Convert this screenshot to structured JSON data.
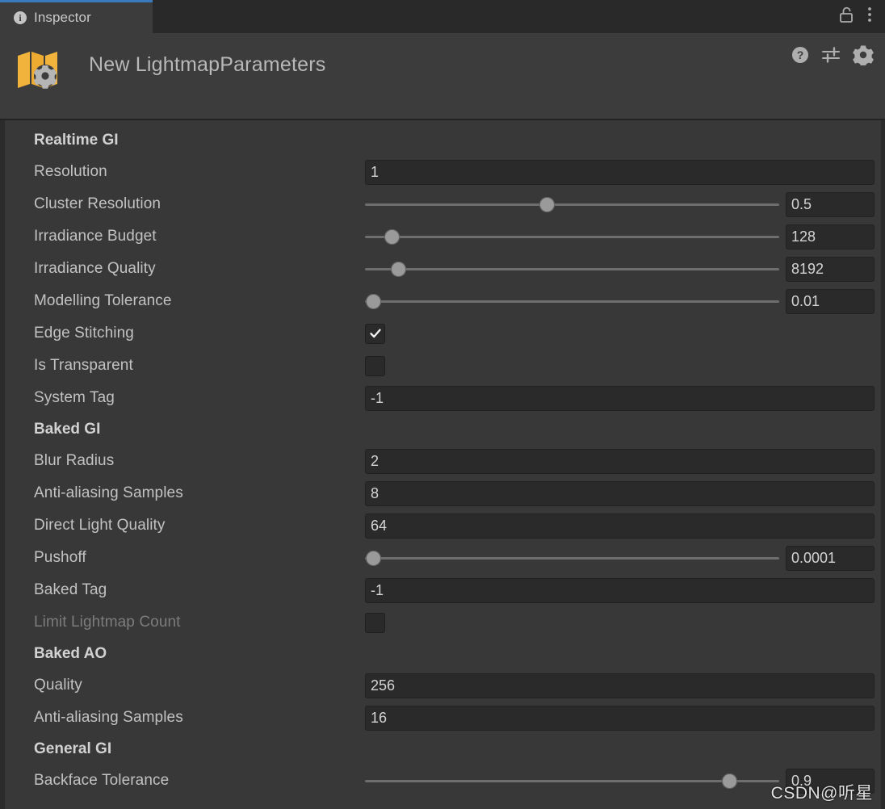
{
  "window": {
    "tab": {
      "label": "Inspector",
      "icon": "info-icon"
    },
    "tab_right_icons": [
      "lock-icon",
      "kebab-menu-icon"
    ],
    "accent_color": "#3a79bb"
  },
  "header": {
    "title": "New LightmapParameters",
    "asset_icon": "lightmap-parameters-icon",
    "right_icons": [
      "help-icon",
      "preset-icon",
      "gear-icon"
    ]
  },
  "sections": [
    {
      "title": "Realtime GI",
      "rows": [
        {
          "label": "Resolution",
          "type": "text",
          "value": "1"
        },
        {
          "label": "Cluster Resolution",
          "type": "slider",
          "value": "0.5",
          "pos": 44
        },
        {
          "label": "Irradiance Budget",
          "type": "slider",
          "value": "128",
          "pos": 6.5
        },
        {
          "label": "Irradiance Quality",
          "type": "slider",
          "value": "8192",
          "pos": 8
        },
        {
          "label": "Modelling Tolerance",
          "type": "slider",
          "value": "0.01",
          "pos": 2
        },
        {
          "label": "Edge Stitching",
          "type": "checkbox",
          "checked": true
        },
        {
          "label": "Is Transparent",
          "type": "checkbox",
          "checked": false
        },
        {
          "label": "System Tag",
          "type": "text",
          "value": "-1"
        }
      ]
    },
    {
      "title": "Baked GI",
      "rows": [
        {
          "label": "Blur Radius",
          "type": "text",
          "value": "2"
        },
        {
          "label": "Anti-aliasing Samples",
          "type": "text",
          "value": "8"
        },
        {
          "label": "Direct Light Quality",
          "type": "text",
          "value": "64"
        },
        {
          "label": "Pushoff",
          "type": "slider",
          "value": "0.0001",
          "pos": 2
        },
        {
          "label": "Baked Tag",
          "type": "text",
          "value": "-1"
        },
        {
          "label": "Limit Lightmap Count",
          "type": "checkbox",
          "checked": false,
          "disabled": true
        }
      ]
    },
    {
      "title": "Baked AO",
      "rows": [
        {
          "label": "Quality",
          "type": "text",
          "value": "256"
        },
        {
          "label": "Anti-aliasing Samples",
          "type": "text",
          "value": "16"
        }
      ]
    },
    {
      "title": "General GI",
      "rows": [
        {
          "label": "Backface Tolerance",
          "type": "slider",
          "value": "0.9",
          "pos": 88
        }
      ]
    }
  ],
  "watermark": {
    "text": "CSDN@听星"
  }
}
